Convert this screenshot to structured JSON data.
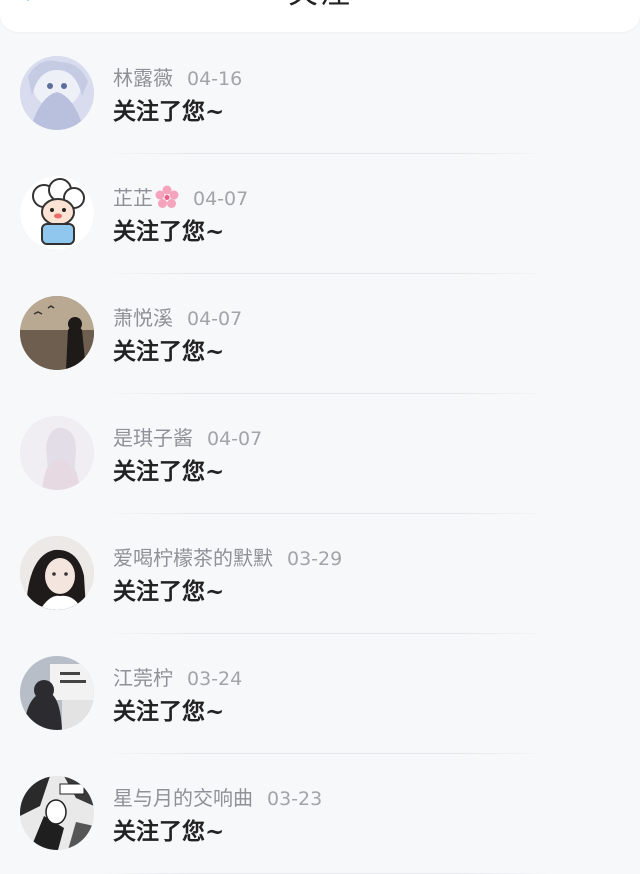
{
  "header": {
    "title": "关注"
  },
  "notifications": [
    {
      "name": "林露薇",
      "date": "04-16",
      "message": "关注了您~",
      "avatar_color": "#c9cfe4"
    },
    {
      "name": "芷芷",
      "date": "04-07",
      "message": "关注了您~",
      "avatar_color": "#f3f5f8",
      "name_icon": "cherry-blossom-icon"
    },
    {
      "name": "萧悦溪",
      "date": "04-07",
      "message": "关注了您~",
      "avatar_color": "#8b7a66"
    },
    {
      "name": "是琪子酱",
      "date": "04-07",
      "message": "关注了您~",
      "avatar_color": "#ebe7ee"
    },
    {
      "name": "爱喝柠檬茶的默默",
      "date": "03-29",
      "message": "关注了您~",
      "avatar_color": "#d9d4cf"
    },
    {
      "name": "江莞柠",
      "date": "03-24",
      "message": "关注了您~",
      "avatar_color": "#c9ccd2"
    },
    {
      "name": "星与月的交响曲",
      "date": "03-23",
      "message": "关注了您~",
      "avatar_color": "#b5b5b5"
    }
  ]
}
